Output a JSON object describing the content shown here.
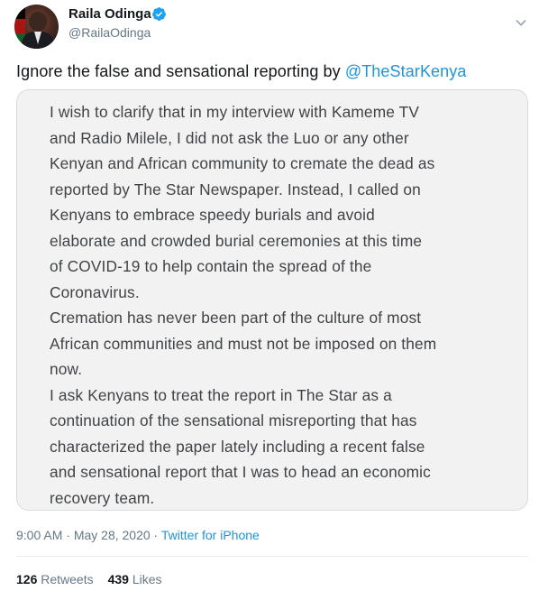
{
  "author": {
    "name": "Raila Odinga",
    "handle": "@RailaOdinga",
    "verified_icon": "verified-badge-icon",
    "avatar_icon": "profile-avatar"
  },
  "tweet": {
    "text_prefix": "Ignore the false and sensational reporting by ",
    "mention": "@TheStarKenya"
  },
  "statement": {
    "paragraphs": [
      {
        "lines": [
          "I wish to clarify that in my interview with Kameme TV",
          "and Radio Milele, I did not ask the Luo or any other",
          "Kenyan and African community to cremate the dead as",
          "reported by The Star Newspaper. Instead, I called on",
          "Kenyans to embrace speedy burials and avoid",
          "elaborate and crowded burial ceremonies at this time",
          "of COVID-19 to help contain the spread of the",
          "Coronavirus."
        ]
      },
      {
        "lines": [
          "Cremation has never been part of the culture of most",
          "African communities and must not be imposed on them",
          "now."
        ]
      },
      {
        "lines": [
          "I ask Kenyans to treat the report in The Star as a",
          "continuation of the sensational misreporting that has",
          "characterized the paper lately including a recent false",
          "and sensational report that I was to head an economic",
          "recovery team."
        ]
      }
    ]
  },
  "meta": {
    "time": "9:00 AM",
    "separator": " · ",
    "date": "May 28, 2020",
    "separator2": " · ",
    "source": "Twitter for iPhone"
  },
  "stats": {
    "retweets_count": "126",
    "retweets_label": "Retweets",
    "likes_count": "439",
    "likes_label": "Likes"
  },
  "colors": {
    "link": "#1b95e0",
    "verified": "#1da1f2",
    "secondary_text": "#657786"
  }
}
